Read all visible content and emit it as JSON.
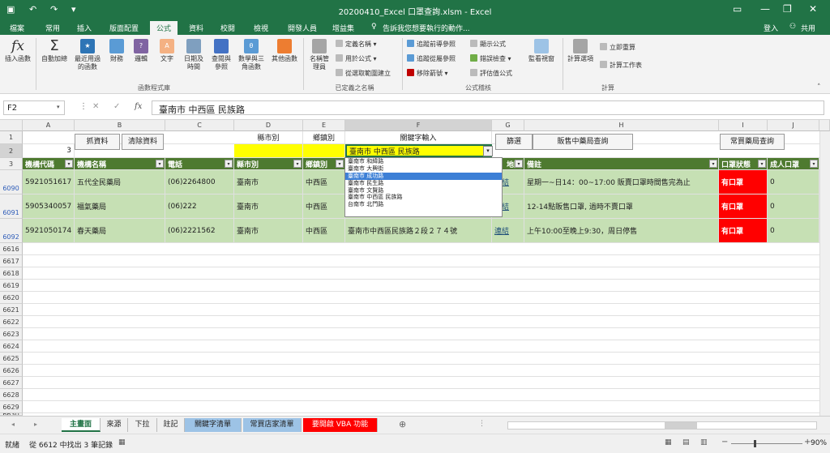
{
  "title": "20200410_Excel 口罩查詢.xlsm - Excel",
  "window_controls": {
    "minimize": "—",
    "restore": "❐",
    "close": "✕"
  },
  "tabs": [
    "檔案",
    "常用",
    "插入",
    "版面配置",
    "公式",
    "資料",
    "校閱",
    "檢視",
    "開發人員",
    "增益集"
  ],
  "active_tab": "公式",
  "tell_me": "告訴我您想要執行的動作...",
  "signin": "登入",
  "share": "共用",
  "ribbon": {
    "insert_function": "插入函數",
    "autosum": "自動加總",
    "recent": "最近用過的函數",
    "financial": "財務",
    "logical": "邏輯",
    "text": "文字",
    "datetime": "日期及時間",
    "lookup": "查閱與參照",
    "math": "數學與三角函數",
    "more": "其他函數",
    "group_library": "函數程式庫",
    "name_manager": "名稱管理員",
    "define_name": "定義名稱",
    "use_in_formula": "用於公式",
    "create_from_sel": "從選取範圍建立",
    "group_names": "已定義之名稱",
    "trace_precedents": "追蹤前導參照",
    "trace_dependents": "追蹤從屬參照",
    "remove_arrows": "移除箭號",
    "show_formulas": "顯示公式",
    "error_checking": "錯誤檢查",
    "evaluate": "評估值公式",
    "group_audit": "公式稽核",
    "watch": "監看視窗",
    "calc_options": "計算選項",
    "calc_now": "立即重算",
    "calc_sheet": "計算工作表",
    "group_calc": "計算"
  },
  "formula_bar": {
    "name_box": "F2",
    "fx": "fx",
    "cancel": "✕",
    "enter": "✓",
    "value": "臺南市 中西區 民族路"
  },
  "columns": [
    "A",
    "B",
    "C",
    "D",
    "E",
    "F",
    "G",
    "H",
    "I",
    "J"
  ],
  "row_numbers": [
    "1",
    "2",
    "3",
    "6090",
    "6091",
    "6092",
    "6616",
    "6617",
    "6618",
    "6619",
    "6620",
    "6621",
    "6622",
    "6623",
    "6624",
    "6625",
    "6626",
    "6627",
    "6628",
    "6629",
    "6630"
  ],
  "buttons": {
    "fetch": "抓資料",
    "clear": "清除資料",
    "filter": "篩選",
    "sell_query": "販售中藥局查詢",
    "common_query": "常買藥局查詢"
  },
  "labels": {
    "county": "縣市別",
    "township": "鄉鎮別",
    "keyword": "關鍵字輸入",
    "a2": "3"
  },
  "keyword_value": "臺南市 中西區 民族路",
  "headers": [
    "機構代碼",
    "機構名稱",
    "電話",
    "縣市別",
    "鄉鎮別",
    "地址",
    "地圖",
    "備註",
    "口罩狀態",
    "成人口罩"
  ],
  "rows": [
    {
      "code": "5921051617",
      "name": "五代全民藥局",
      "phone": "(06)2264800",
      "county": "臺南市",
      "town": "中西區",
      "addr": "",
      "map": "連結",
      "note": "星期一~日14：00~17:00 販賣口罩時間售完為止",
      "status": "有口罩",
      "adult": "0"
    },
    {
      "code": "5905340057",
      "name": "福氣藥局",
      "phone": "(06)222",
      "county": "臺南市",
      "town": "中西區",
      "addr": "",
      "map": "連結",
      "note": "12-14點販售口罩, 過時不賣口罩",
      "status": "有口罩",
      "adult": "0"
    },
    {
      "code": "5921050174",
      "name": "春天藥局",
      "phone": "(06)2221562",
      "county": "臺南市",
      "town": "中西區",
      "addr": "臺南市中西區民族路２段２７４號",
      "map": "連結",
      "note": "上午10:00至晚上9:30，周日停售",
      "status": "有口罩",
      "adult": "0"
    }
  ],
  "dropdown": [
    "臺南市 和緯路",
    "臺南市 大興街",
    "臺南市 成功路",
    "臺南市 民生路",
    "臺南市 文賢路",
    "臺南市 中西區 民族路",
    "台南市 北門路"
  ],
  "dropdown_selected": 2,
  "sheets": [
    "主畫面",
    "來源",
    "下拉",
    "註記",
    "關鍵字清單",
    "常買店家清單",
    "要開啟 VBA 功能"
  ],
  "status_text": "就緒",
  "status_found": "從 6612 中找出 3 筆記錄",
  "zoom": "90%",
  "colors": {
    "excel_green": "#217346",
    "header_green": "#4e7a30",
    "row_green": "#c6e0b4",
    "yellow": "#ffff00",
    "red": "#ff0000",
    "vba_tab": "#ff0000",
    "blue_tab": "#9dc3e6"
  }
}
